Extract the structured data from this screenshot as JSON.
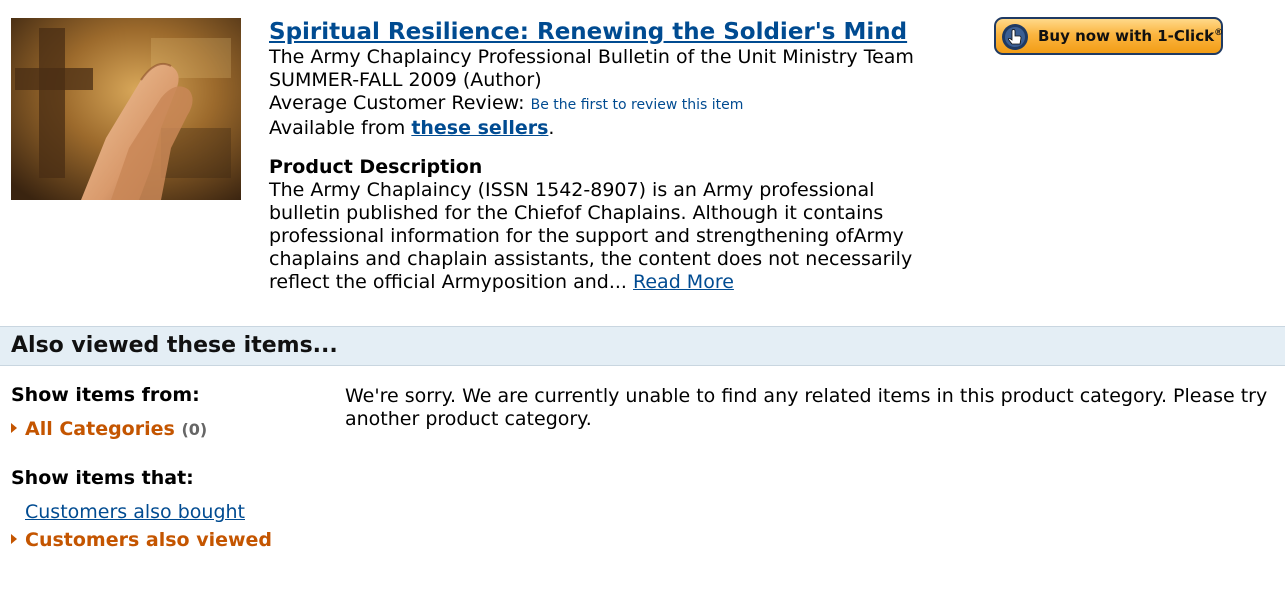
{
  "product": {
    "title": "Spiritual Resilience: Renewing the Soldier's Mind",
    "author_line1": "The Army Chaplaincy Professional Bulletin of the Unit Ministry Team",
    "author_line2": "SUMMER-FALL 2009 (Author)",
    "review_label": "Average Customer Review:",
    "review_link": "Be the first to review this item",
    "available_prefix": "Available from",
    "sellers_link": "these sellers",
    "available_suffix": ".",
    "image_icon": "praying-hands-cross-image"
  },
  "description": {
    "heading": "Product Description",
    "lines": [
      "The Army Chaplaincy (ISSN 1542-8907) is an Army professional",
      "bulletin published for the Chiefof Chaplains. Although it contains",
      "professional information for the support and strengthening ofArmy",
      "chaplains and chaplain assistants, the content does not necessarily",
      "reflect the official Armyposition and..."
    ],
    "read_more": "Read More"
  },
  "buy_button": {
    "label": "Buy now with 1-Click",
    "reg_mark": "®",
    "icon": "cursor-hand-icon"
  },
  "also_viewed": {
    "title": "Also viewed these items...",
    "show_from_heading": "Show items from:",
    "all_categories_label": "All Categories",
    "all_categories_count": "(0)",
    "show_that_heading": "Show items that:",
    "customers_bought": "Customers also bought",
    "customers_viewed": "Customers also viewed",
    "message_lines": [
      "We're sorry. We are currently unable to find any related items in this product category. Please try",
      "another product category."
    ]
  },
  "colors": {
    "link": "#004b91",
    "accent": "#c45500",
    "band": "#e4eef5"
  }
}
